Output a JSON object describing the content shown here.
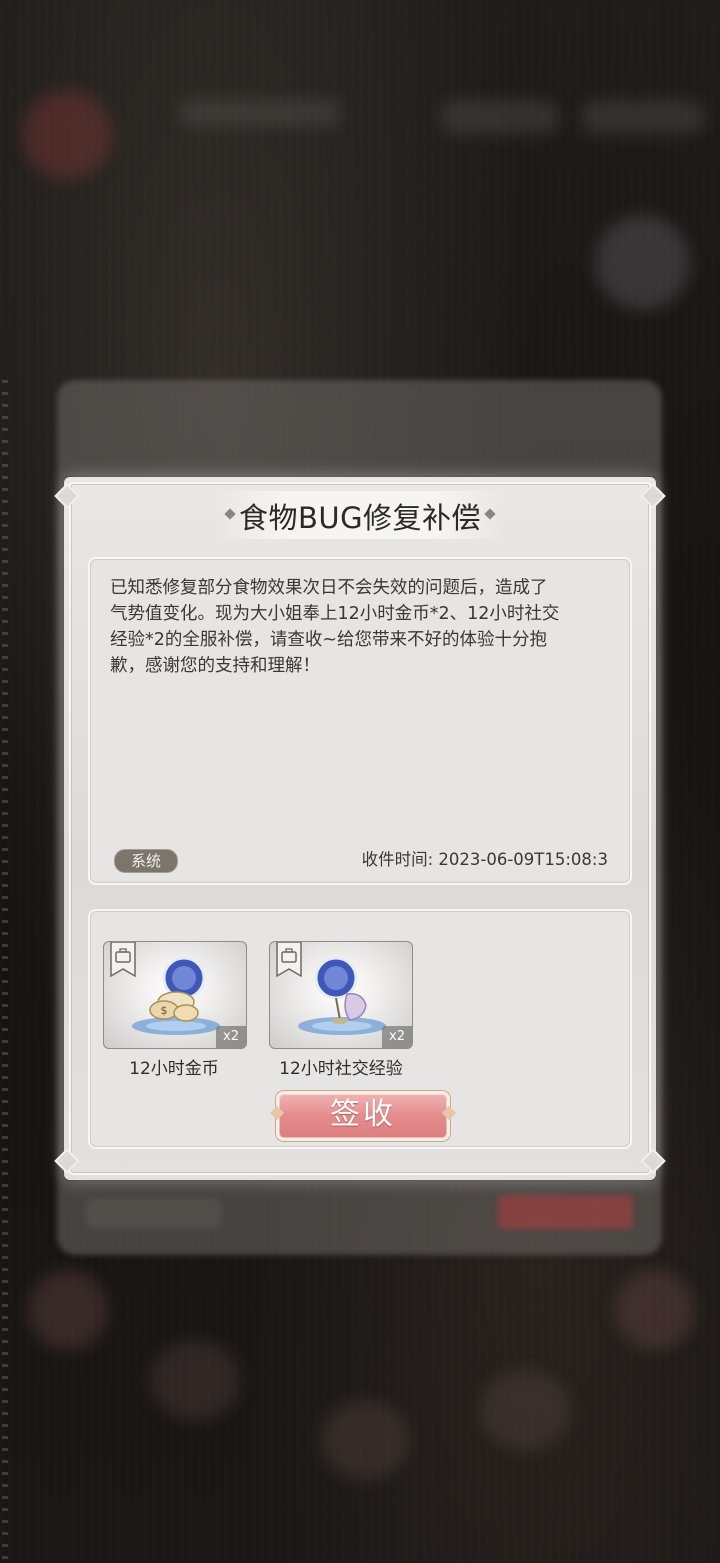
{
  "mail": {
    "title": "食物BUG修复补偿",
    "body": "已知悉修复部分食物效果次日不会失效的问题后，造成了\n气势值变化。现为大小姐奉上12小时金币*2、12小时社交\n经验*2的全服补偿，请查收~给您带来不好的体验十分抱\n歉，感谢您的支持和理解！",
    "tag": "系统",
    "received_time": "收件时间: 2023-06-09T15:08:3"
  },
  "attachments": [
    {
      "label": "12小时金币",
      "quantity": "x2",
      "icon": "gold-coin-boost-icon"
    },
    {
      "label": "12小时社交经验",
      "quantity": "x2",
      "icon": "social-exp-boost-icon"
    }
  ],
  "actions": {
    "claim_label": "签收"
  },
  "colors": {
    "claim_button": "#e48c8c",
    "tag_bg": "#7b756c",
    "panel_bg": "#e6e5e3"
  }
}
